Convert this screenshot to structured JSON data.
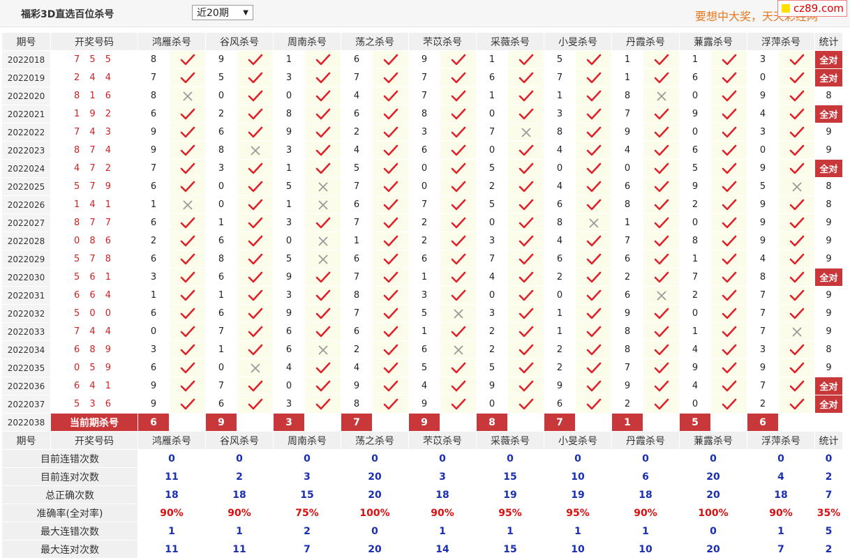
{
  "page": {
    "title": "福彩3D直选百位杀号",
    "period_select": "近20期",
    "slogan": "要想中大奖，天天彩经网",
    "badge": "cz89.com"
  },
  "headers": {
    "period": "期号",
    "draw": "开奖号码",
    "stat": "统计",
    "experts": [
      "鸿雁杀号",
      "谷风杀号",
      "周南杀号",
      "荡之杀号",
      "芣苡杀号",
      "采薇杀号",
      "小旻杀号",
      "丹霞杀号",
      "蒹露杀号",
      "浮萍杀号"
    ]
  },
  "all_pass_label": "全对",
  "rows": [
    {
      "period": "2022018",
      "draw": "7 5 5",
      "kills": [
        8,
        9,
        1,
        6,
        9,
        1,
        5,
        1,
        1,
        3
      ],
      "ok": [
        1,
        1,
        1,
        1,
        1,
        1,
        1,
        1,
        1,
        1
      ],
      "stat": "全对"
    },
    {
      "period": "2022019",
      "draw": "2 4 4",
      "kills": [
        7,
        5,
        3,
        7,
        7,
        6,
        7,
        1,
        6,
        0
      ],
      "ok": [
        1,
        1,
        1,
        1,
        1,
        1,
        1,
        1,
        1,
        1
      ],
      "stat": "全对"
    },
    {
      "period": "2022020",
      "draw": "8 1 6",
      "kills": [
        8,
        0,
        0,
        4,
        7,
        1,
        1,
        8,
        0,
        9
      ],
      "ok": [
        0,
        1,
        1,
        1,
        1,
        1,
        1,
        0,
        1,
        1
      ],
      "stat": "8"
    },
    {
      "period": "2022021",
      "draw": "1 9 2",
      "kills": [
        6,
        2,
        8,
        6,
        8,
        0,
        3,
        7,
        9,
        4
      ],
      "ok": [
        1,
        1,
        1,
        1,
        1,
        1,
        1,
        1,
        1,
        1
      ],
      "stat": "全对"
    },
    {
      "period": "2022022",
      "draw": "7 4 3",
      "kills": [
        9,
        6,
        9,
        2,
        3,
        7,
        8,
        9,
        0,
        3
      ],
      "ok": [
        1,
        1,
        1,
        1,
        1,
        0,
        1,
        1,
        1,
        1
      ],
      "stat": "9"
    },
    {
      "period": "2022023",
      "draw": "8 7 4",
      "kills": [
        9,
        8,
        3,
        4,
        6,
        0,
        4,
        4,
        6,
        0
      ],
      "ok": [
        1,
        0,
        1,
        1,
        1,
        1,
        1,
        1,
        1,
        1
      ],
      "stat": "9"
    },
    {
      "period": "2022024",
      "draw": "4 7 2",
      "kills": [
        7,
        3,
        1,
        5,
        0,
        5,
        0,
        0,
        5,
        9
      ],
      "ok": [
        1,
        1,
        1,
        1,
        1,
        1,
        1,
        1,
        1,
        1
      ],
      "stat": "全对"
    },
    {
      "period": "2022025",
      "draw": "5 7 9",
      "kills": [
        6,
        0,
        5,
        7,
        0,
        2,
        4,
        6,
        9,
        5
      ],
      "ok": [
        1,
        1,
        0,
        1,
        1,
        1,
        1,
        1,
        1,
        0
      ],
      "stat": "8"
    },
    {
      "period": "2022026",
      "draw": "1 4 1",
      "kills": [
        1,
        0,
        1,
        6,
        7,
        5,
        6,
        8,
        2,
        9
      ],
      "ok": [
        0,
        1,
        0,
        1,
        1,
        1,
        1,
        1,
        1,
        1
      ],
      "stat": "8"
    },
    {
      "period": "2022027",
      "draw": "8 7 7",
      "kills": [
        6,
        1,
        3,
        7,
        2,
        0,
        8,
        1,
        0,
        9
      ],
      "ok": [
        1,
        1,
        1,
        1,
        1,
        1,
        0,
        1,
        1,
        1
      ],
      "stat": "9"
    },
    {
      "period": "2022028",
      "draw": "0 8 6",
      "kills": [
        2,
        6,
        0,
        1,
        2,
        3,
        4,
        7,
        8,
        9
      ],
      "ok": [
        1,
        1,
        0,
        1,
        1,
        1,
        1,
        1,
        1,
        1
      ],
      "stat": "9"
    },
    {
      "period": "2022029",
      "draw": "5 7 8",
      "kills": [
        6,
        8,
        5,
        6,
        6,
        7,
        6,
        6,
        1,
        4
      ],
      "ok": [
        1,
        1,
        0,
        1,
        1,
        1,
        1,
        1,
        1,
        1
      ],
      "stat": "9"
    },
    {
      "period": "2022030",
      "draw": "5 6 1",
      "kills": [
        3,
        6,
        9,
        7,
        1,
        4,
        2,
        2,
        7,
        8
      ],
      "ok": [
        1,
        1,
        1,
        1,
        1,
        1,
        1,
        1,
        1,
        1
      ],
      "stat": "全对"
    },
    {
      "period": "2022031",
      "draw": "6 6 4",
      "kills": [
        1,
        1,
        3,
        8,
        3,
        0,
        0,
        6,
        2,
        7
      ],
      "ok": [
        1,
        1,
        1,
        1,
        1,
        1,
        1,
        0,
        1,
        1
      ],
      "stat": "9"
    },
    {
      "period": "2022032",
      "draw": "5 0 0",
      "kills": [
        6,
        6,
        9,
        7,
        5,
        3,
        1,
        9,
        0,
        7
      ],
      "ok": [
        1,
        1,
        1,
        1,
        0,
        1,
        1,
        1,
        1,
        1
      ],
      "stat": "9"
    },
    {
      "period": "2022033",
      "draw": "7 4 4",
      "kills": [
        0,
        7,
        6,
        6,
        1,
        2,
        1,
        8,
        1,
        7
      ],
      "ok": [
        1,
        1,
        1,
        1,
        1,
        1,
        1,
        1,
        1,
        0
      ],
      "stat": "9"
    },
    {
      "period": "2022034",
      "draw": "6 8 9",
      "kills": [
        3,
        1,
        6,
        2,
        6,
        2,
        2,
        8,
        4,
        3
      ],
      "ok": [
        1,
        1,
        0,
        1,
        0,
        1,
        1,
        1,
        1,
        1
      ],
      "stat": "8"
    },
    {
      "period": "2022035",
      "draw": "0 5 9",
      "kills": [
        6,
        0,
        4,
        4,
        5,
        5,
        2,
        7,
        9,
        9
      ],
      "ok": [
        1,
        0,
        1,
        1,
        1,
        1,
        1,
        1,
        1,
        1
      ],
      "stat": "9"
    },
    {
      "period": "2022036",
      "draw": "6 4 1",
      "kills": [
        9,
        7,
        0,
        9,
        4,
        9,
        9,
        9,
        4,
        7
      ],
      "ok": [
        1,
        1,
        1,
        1,
        1,
        1,
        1,
        1,
        1,
        1
      ],
      "stat": "全对"
    },
    {
      "period": "2022037",
      "draw": "5 3 6",
      "kills": [
        9,
        6,
        3,
        8,
        9,
        0,
        6,
        2,
        0,
        2
      ],
      "ok": [
        1,
        1,
        1,
        1,
        1,
        1,
        1,
        1,
        1,
        1
      ],
      "stat": "全对"
    }
  ],
  "current": {
    "period": "2022038",
    "label": "当前期杀号",
    "kills": [
      6,
      9,
      3,
      7,
      9,
      8,
      7,
      1,
      5,
      6
    ]
  },
  "summary": [
    {
      "label": "目前连错次数",
      "values": [
        "0",
        "0",
        "0",
        "0",
        "0",
        "0",
        "0",
        "0",
        "0",
        "0"
      ],
      "stat": "0",
      "kind": "num"
    },
    {
      "label": "目前连对次数",
      "values": [
        "11",
        "2",
        "3",
        "20",
        "3",
        "15",
        "10",
        "6",
        "20",
        "4"
      ],
      "stat": "2",
      "kind": "num"
    },
    {
      "label": "总正确次数",
      "values": [
        "18",
        "18",
        "15",
        "20",
        "18",
        "19",
        "19",
        "18",
        "20",
        "18"
      ],
      "stat": "7",
      "kind": "num"
    },
    {
      "label": "准确率(全对率)",
      "values": [
        "90%",
        "90%",
        "75%",
        "100%",
        "90%",
        "95%",
        "95%",
        "90%",
        "100%",
        "90%"
      ],
      "stat": "35%",
      "kind": "rate"
    },
    {
      "label": "最大连错次数",
      "values": [
        "1",
        "1",
        "2",
        "0",
        "1",
        "1",
        "1",
        "1",
        "0",
        "1"
      ],
      "stat": "5",
      "kind": "num"
    },
    {
      "label": "最大连对次数",
      "values": [
        "11",
        "11",
        "7",
        "20",
        "14",
        "15",
        "10",
        "10",
        "20",
        "7"
      ],
      "stat": "2",
      "kind": "num"
    }
  ]
}
